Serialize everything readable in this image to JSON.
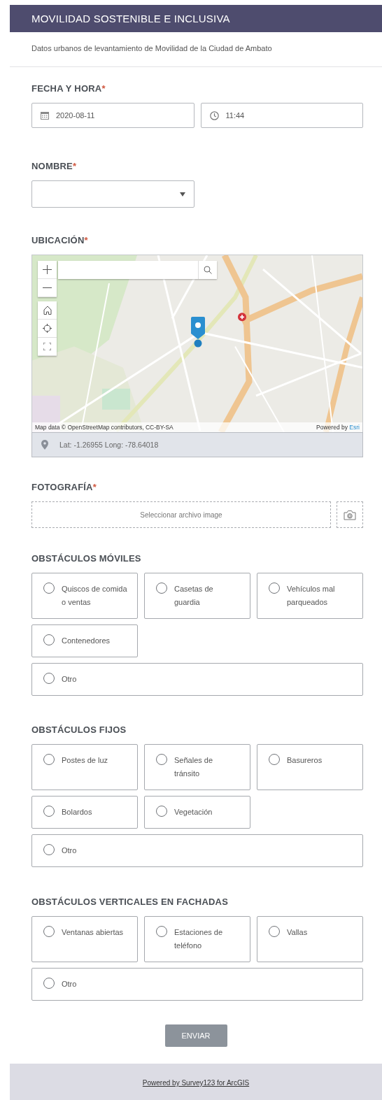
{
  "header": {
    "title": "MOVILIDAD SOSTENIBLE E INCLUSIVA",
    "subtitle": "Datos urbanos de levantamiento de Movilidad de la Ciudad de Ambato"
  },
  "questions": [
    {
      "kind": "datetime",
      "label": "FECHA Y HORA",
      "required_mark": "*",
      "date": "2020-08-11",
      "time": "11:44"
    },
    {
      "kind": "select",
      "label": "NOMBRE",
      "required_mark": "*"
    },
    {
      "kind": "map",
      "label": "UBICACIÓN",
      "required_mark": "*",
      "attribution": "Map data © OpenStreetMap contributors, CC-BY-SA",
      "powered_prefix": "Powered by",
      "powered_link": "Esri",
      "coordinates": "Lat: -1.26955  Long: -78.64018"
    },
    {
      "label": "FOTOGRAFÍA",
      "required_mark": "*",
      "placeholder": "Seleccionar archivo image"
    },
    {
      "kind": "radio",
      "label": "OBSTÁCULOS MÓVILES",
      "options": [
        {
          "kind": "choice",
          "label": "Quiscos de comida o ventas",
          "selected": false
        },
        {
          "kind": "choice",
          "label": "Casetas de guardia",
          "selected": false
        },
        {
          "kind": "choice",
          "label": "Vehículos mal parqueados",
          "selected": false
        },
        {
          "kind": "choice",
          "label": "Contenedores",
          "selected": false
        },
        {
          "kind": "other",
          "label": "Otro",
          "selected": false
        }
      ]
    },
    {
      "kind": "radio",
      "label": "OBSTÁCULOS FIJOS",
      "options": [
        {
          "kind": "choice",
          "label": "Postes de luz",
          "selected": false
        },
        {
          "kind": "choice",
          "label": "Señales de tránsito",
          "selected": false
        },
        {
          "kind": "choice",
          "label": "Basureros",
          "selected": false
        },
        {
          "kind": "choice",
          "label": "Bolardos",
          "selected": false
        },
        {
          "kind": "choice",
          "label": "Vegetación",
          "selected": false
        },
        {
          "kind": "other",
          "label": "Otro",
          "selected": false
        }
      ]
    },
    {
      "kind": "radio",
      "label": "OBSTÁCULOS VERTICALES EN FACHADAS",
      "options": [
        {
          "kind": "choice",
          "label": "Ventanas abiertas",
          "selected": false
        },
        {
          "kind": "choice",
          "label": "Estaciones de teléfono",
          "selected": false
        },
        {
          "kind": "choice",
          "label": "Vallas",
          "selected": false
        },
        {
          "kind": "other",
          "label": "Otro",
          "selected": false
        }
      ]
    }
  ],
  "submit": {
    "label": "ENVIAR"
  },
  "footer": {
    "link": "Powered by Survey123 for ArcGIS"
  }
}
